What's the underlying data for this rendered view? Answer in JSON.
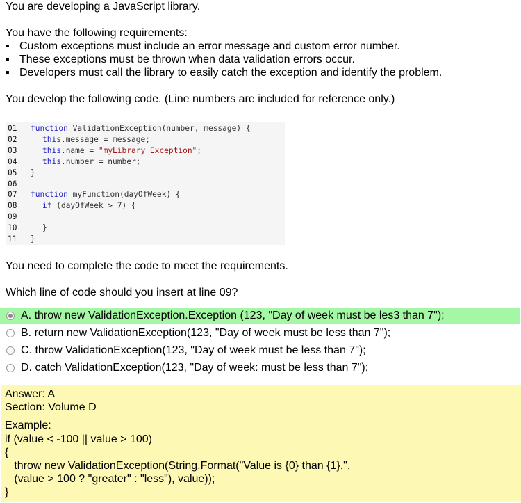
{
  "intro": "You are developing a JavaScript library.",
  "req_heading": "You have the following requirements:",
  "requirements": [
    "Custom exceptions must include an error message and custom error number.",
    "These exceptions must be thrown when data validation errors occur.",
    "Developers must call the library to easily catch the exception and identify the problem."
  ],
  "bullet_char": "▪",
  "develop_text": "You develop the following code. (Line numbers are included for reference only.)",
  "code": {
    "line_numbers": [
      "01",
      "02",
      "03",
      "04",
      "05",
      "06",
      "07",
      "08",
      "09",
      "10",
      "11"
    ],
    "l01_kw": "function",
    "l01_rest": " ValidationException(number, message) {",
    "l02_kw": "this",
    "l02_rest": ".message = message;",
    "l03_kw": "this",
    "l03_rest": ".name = ",
    "l03_str": "\"myLibrary Exception\"",
    "l03_end": ";",
    "l04_kw": "this",
    "l04_rest": ".number = number;",
    "l05": "}",
    "l07_kw": "function",
    "l07_rest": " myFunction(dayOfWeek) {",
    "l08_kw": "if",
    "l08_rest": " (dayOfWeek > 7) {",
    "l10": "}",
    "l11": "}"
  },
  "need_text": "You need to complete the code to meet the requirements.",
  "question": "Which line of code should you insert at line 09?",
  "options": [
    "A. throw new ValidationException.Exception (123, \"Day of week must be les3 than 7\");",
    "B. return new ValidationException(123, \"Day of week must be less than 7\");",
    "C. throw ValidationException(123, \"Day of week must be less than 7\");",
    "D. catch ValidationException(123, \"Day of week: must be less than 7\");"
  ],
  "selected_option": "A",
  "answer": {
    "answer_line": "Answer: A",
    "section_line": "Section: Volume D",
    "example_label": "Example:",
    "example_lines": [
      "if (value < -100 || value > 100)",
      "{",
      "   throw new ValidationException(String.Format(\"Value is {0} than {1}.\",",
      "   (value > 100 ? \"greater\" : \"less\"), value));",
      "}"
    ]
  },
  "colors": {
    "selected_bg": "#a4f7a4",
    "answer_bg": "#fdf8b4",
    "keyword": "#1d1dc4",
    "string": "#a31515"
  }
}
